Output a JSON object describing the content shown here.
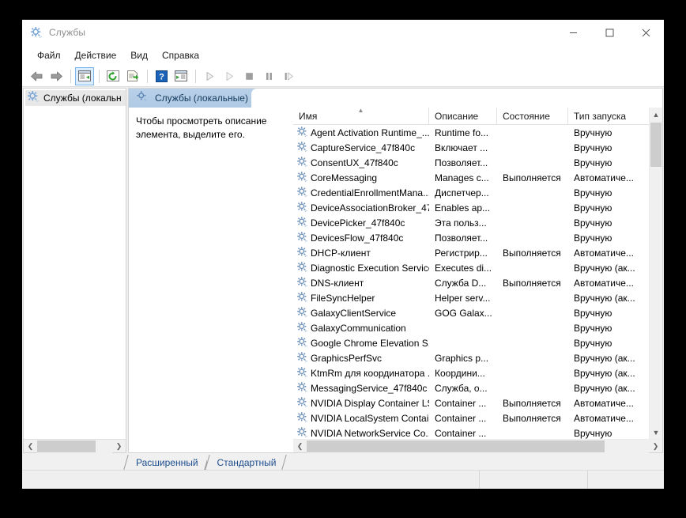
{
  "window": {
    "title": "Службы",
    "icon": "services-gear-icon",
    "controls": {
      "minimize": "minimize-icon",
      "maximize": "maximize-icon",
      "close": "close-icon"
    }
  },
  "menubar": {
    "items": [
      {
        "label": "Файл",
        "name": "menu-file"
      },
      {
        "label": "Действие",
        "name": "menu-action"
      },
      {
        "label": "Вид",
        "name": "menu-view"
      },
      {
        "label": "Справка",
        "name": "menu-help"
      }
    ]
  },
  "toolbar": {
    "items": [
      {
        "name": "back-button",
        "icon": "arrow-left-icon",
        "enabled": true
      },
      {
        "name": "forward-button",
        "icon": "arrow-right-icon",
        "enabled": true
      },
      {
        "name": "show-hide-console-tree-button",
        "icon": "console-tree-icon",
        "selected": true
      },
      {
        "name": "refresh-button",
        "icon": "refresh-icon",
        "enabled": true
      },
      {
        "name": "export-list-button",
        "icon": "export-list-icon",
        "enabled": true
      },
      {
        "name": "help-button",
        "icon": "question-mark-icon",
        "enabled": true
      },
      {
        "name": "properties-button",
        "icon": "properties-window-icon",
        "enabled": true
      },
      {
        "name": "start-service-button",
        "icon": "play-icon",
        "enabled": false
      },
      {
        "name": "restart-service-button",
        "icon": "play-outline-icon",
        "enabled": false
      },
      {
        "name": "stop-service-button",
        "icon": "stop-square-icon",
        "enabled": false
      },
      {
        "name": "pause-service-button",
        "icon": "pause-icon",
        "enabled": false
      },
      {
        "name": "resume-service-button",
        "icon": "resume-icon",
        "enabled": false
      }
    ]
  },
  "tree": {
    "root": {
      "label": "Службы (локальн",
      "icon": "services-gear-icon",
      "selected": true
    }
  },
  "pane": {
    "header_title": "Службы (локальные)",
    "header_icon": "services-gear-icon",
    "description_hint": "Чтобы просмотреть описание элемента, выделите его."
  },
  "list": {
    "columns": [
      {
        "label": "Имя",
        "name": "column-name",
        "sorted": "asc"
      },
      {
        "label": "Описание",
        "name": "column-description"
      },
      {
        "label": "Состояние",
        "name": "column-status"
      },
      {
        "label": "Тип запуска",
        "name": "column-startup-type"
      }
    ],
    "rows": [
      {
        "name": "Agent Activation Runtime_...",
        "description": "Runtime fo...",
        "status": "",
        "startup": "Вручную"
      },
      {
        "name": "CaptureService_47f840c",
        "description": "Включает ...",
        "status": "",
        "startup": "Вручную"
      },
      {
        "name": "ConsentUX_47f840c",
        "description": "Позволяет...",
        "status": "",
        "startup": "Вручную"
      },
      {
        "name": "CoreMessaging",
        "description": "Manages c...",
        "status": "Выполняется",
        "startup": "Автоматиче..."
      },
      {
        "name": "CredentialEnrollmentMana...",
        "description": "Диспетчер...",
        "status": "",
        "startup": "Вручную"
      },
      {
        "name": "DeviceAssociationBroker_47...",
        "description": "Enables ap...",
        "status": "",
        "startup": "Вручную"
      },
      {
        "name": "DevicePicker_47f840c",
        "description": "Эта польз...",
        "status": "",
        "startup": "Вручную"
      },
      {
        "name": "DevicesFlow_47f840c",
        "description": "Позволяет...",
        "status": "",
        "startup": "Вручную"
      },
      {
        "name": "DHCP-клиент",
        "description": "Регистрир...",
        "status": "Выполняется",
        "startup": "Автоматиче..."
      },
      {
        "name": "Diagnostic Execution Service",
        "description": "Executes di...",
        "status": "",
        "startup": "Вручную (ак..."
      },
      {
        "name": "DNS-клиент",
        "description": "Служба D...",
        "status": "Выполняется",
        "startup": "Автоматиче..."
      },
      {
        "name": "FileSyncHelper",
        "description": "Helper serv...",
        "status": "",
        "startup": "Вручную (ак..."
      },
      {
        "name": "GalaxyClientService",
        "description": "GOG Galax...",
        "status": "",
        "startup": "Вручную"
      },
      {
        "name": "GalaxyCommunication",
        "description": "",
        "status": "",
        "startup": "Вручную"
      },
      {
        "name": "Google Chrome Elevation S...",
        "description": "",
        "status": "",
        "startup": "Вручную"
      },
      {
        "name": "GraphicsPerfSvc",
        "description": "Graphics p...",
        "status": "",
        "startup": "Вручную (ак..."
      },
      {
        "name": "KtmRm для координатора ...",
        "description": "Координи...",
        "status": "",
        "startup": "Вручную (ак..."
      },
      {
        "name": "MessagingService_47f840c",
        "description": "Служба, о...",
        "status": "",
        "startup": "Вручную (ак..."
      },
      {
        "name": "NVIDIA Display Container LS",
        "description": "Container ...",
        "status": "Выполняется",
        "startup": "Автоматиче..."
      },
      {
        "name": "NVIDIA LocalSystem Contai...",
        "description": "Container ...",
        "status": "Выполняется",
        "startup": "Автоматиче..."
      },
      {
        "name": "NVIDIA NetworkService Co...",
        "description": "Container ...",
        "status": "",
        "startup": "Вручную"
      }
    ],
    "row_icon": "service-gear-icon"
  },
  "tabs": [
    {
      "label": "Расширенный",
      "name": "tab-extended",
      "active": true
    },
    {
      "label": "Стандартный",
      "name": "tab-standard",
      "active": false
    }
  ],
  "statusbar": {
    "main": "",
    "pane_a": "",
    "pane_b": ""
  },
  "colors": {
    "pane_header_top": "#b9d0e8",
    "pane_header_bottom": "#afc9e4",
    "tab_text": "#1d4e8f",
    "title_text": "#8d8d8d",
    "scroll_thumb": "#cdcdcd",
    "toolbar_selected_bg": "#dbeeff",
    "toolbar_selected_border": "#7eb4ea"
  }
}
